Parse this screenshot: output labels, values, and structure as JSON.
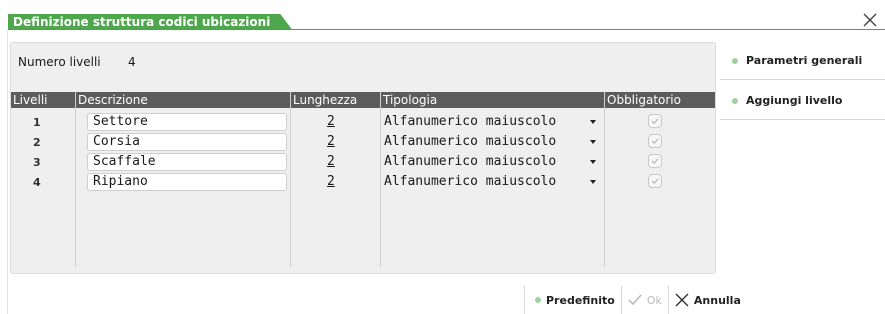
{
  "window": {
    "title": "Definizione struttura codici ubicazioni"
  },
  "form": {
    "num_livelli_label": "Numero livelli",
    "num_livelli_value": "4"
  },
  "table": {
    "headers": [
      "Livelli",
      "Descrizione",
      "Lunghezza",
      "Tipologia",
      "Obbligatorio"
    ],
    "rows": [
      {
        "livello": "1",
        "descrizione": "Settore",
        "lunghezza": "2",
        "tipologia": "Alfanumerico maiuscolo",
        "obbligatorio": true
      },
      {
        "livello": "2",
        "descrizione": "Corsia",
        "lunghezza": "2",
        "tipologia": "Alfanumerico maiuscolo",
        "obbligatorio": true
      },
      {
        "livello": "3",
        "descrizione": "Scaffale",
        "lunghezza": "2",
        "tipologia": "Alfanumerico maiuscolo",
        "obbligatorio": true
      },
      {
        "livello": "4",
        "descrizione": "Ripiano",
        "lunghezza": "2",
        "tipologia": "Alfanumerico maiuscolo",
        "obbligatorio": true
      }
    ]
  },
  "side_actions": {
    "parametri": "Parametri generali",
    "aggiungi": "Aggiungi livello"
  },
  "bottom_actions": {
    "predefinito": "Predefinito",
    "ok": "Ok",
    "annulla": "Annulla"
  },
  "colors": {
    "accent": "#4ea74c",
    "header_bg": "#5c5c5c",
    "panel_bg": "#efefef",
    "dot": "#9fd19c"
  },
  "icons": {
    "close": "close-icon",
    "check": "check-icon",
    "dropdown": "chevron-down-icon"
  }
}
